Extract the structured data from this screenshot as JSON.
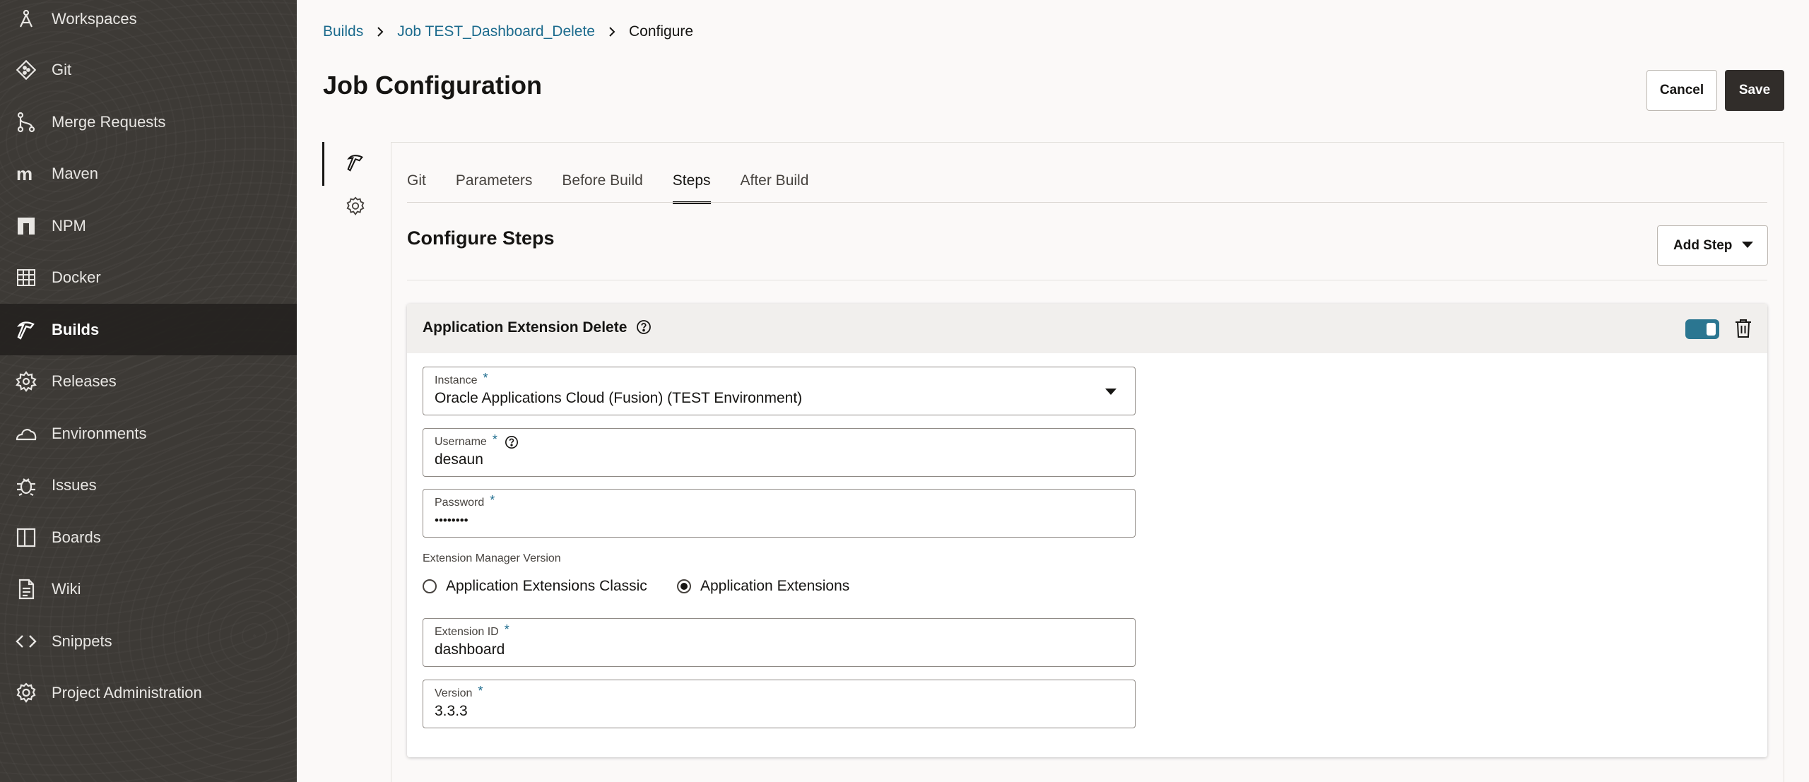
{
  "sidebar": {
    "items": [
      {
        "label": "Workspaces",
        "icon": "workspaces-icon"
      },
      {
        "label": "Git",
        "icon": "git-icon"
      },
      {
        "label": "Merge Requests",
        "icon": "merge-requests-icon"
      },
      {
        "label": "Maven",
        "icon": "maven-icon"
      },
      {
        "label": "NPM",
        "icon": "npm-icon"
      },
      {
        "label": "Docker",
        "icon": "docker-icon"
      },
      {
        "label": "Builds",
        "icon": "builds-hammer-icon",
        "active": true
      },
      {
        "label": "Releases",
        "icon": "releases-icon"
      },
      {
        "label": "Environments",
        "icon": "environments-cloud-icon"
      },
      {
        "label": "Issues",
        "icon": "issues-bug-icon"
      },
      {
        "label": "Boards",
        "icon": "boards-icon"
      },
      {
        "label": "Wiki",
        "icon": "wiki-document-icon"
      },
      {
        "label": "Snippets",
        "icon": "snippets-code-icon"
      },
      {
        "label": "Project Administration",
        "icon": "project-administration-gear-icon"
      }
    ]
  },
  "breadcrumb": {
    "items": [
      "Builds",
      "Job TEST_Dashboard_Delete"
    ],
    "current": "Configure"
  },
  "header": {
    "title": "Job Configuration",
    "cancel_label": "Cancel",
    "save_label": "Save"
  },
  "tabs": {
    "items": [
      "Git",
      "Parameters",
      "Before Build",
      "Steps",
      "After Build"
    ],
    "active": "Steps"
  },
  "section": {
    "title": "Configure Steps",
    "add_step_label": "Add Step"
  },
  "step": {
    "title": "Application Extension Delete",
    "enabled": true,
    "fields": {
      "instance": {
        "label": "Instance",
        "value": "Oracle Applications Cloud (Fusion) (TEST Environment)"
      },
      "username": {
        "label": "Username",
        "value": "desaun"
      },
      "password": {
        "label": "Password",
        "value": "••••••••"
      },
      "extension_id": {
        "label": "Extension ID",
        "value": "dashboard"
      },
      "version": {
        "label": "Version",
        "value": "3.3.3"
      }
    },
    "required_marker": "*",
    "extension_manager": {
      "label": "Extension Manager Version",
      "options": [
        "Application Extensions Classic",
        "Application Extensions"
      ],
      "selected": "Application Extensions"
    }
  },
  "colors": {
    "sidebar_bg": "#3d3a36",
    "accent": "#1c6b8d",
    "toggle": "#2b7691",
    "primary_button": "#312d2a"
  }
}
